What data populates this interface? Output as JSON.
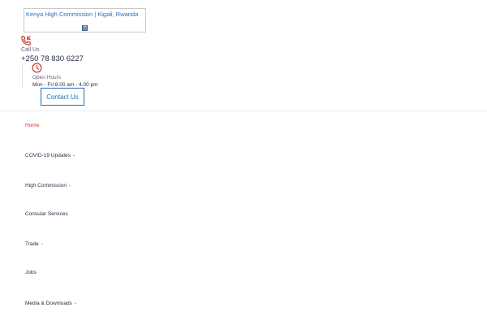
{
  "header": {
    "logo_text": "Kenya High Commission | Kigali, Rwanda",
    "call": {
      "label": "Call Us",
      "number": "+250 78 830 6227",
      "icon": "phone-incoming-icon"
    },
    "hours": {
      "label": "Open Hours",
      "value": "Mon - Fri 8.00 am - 4.00 pm",
      "icon": "clock-icon"
    },
    "contact_button": "Contact Us"
  },
  "nav": {
    "items": [
      {
        "label": "Home",
        "active": true,
        "dropdown": false
      },
      {
        "label": "COVID-19 Updates",
        "active": false,
        "dropdown": true
      },
      {
        "label": "High Commission",
        "active": false,
        "dropdown": true
      },
      {
        "label": "Consular Services",
        "active": false,
        "dropdown": false
      },
      {
        "label": "Trade",
        "active": false,
        "dropdown": true
      },
      {
        "label": "Jobs",
        "active": false,
        "dropdown": false
      },
      {
        "label": "Media & Downloads",
        "active": false,
        "dropdown": true
      }
    ]
  },
  "colors": {
    "accent_red": "#c0392b",
    "accent_blue": "#1e6fb8",
    "text_dark": "#1f2a44"
  }
}
